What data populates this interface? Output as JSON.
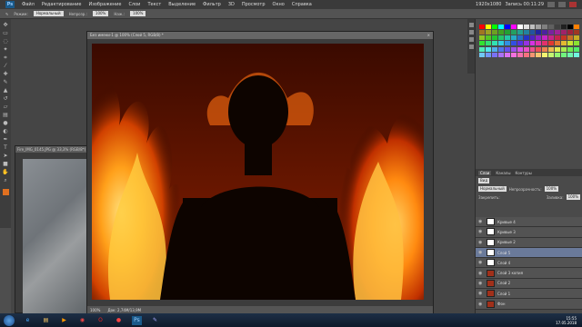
{
  "menubar": {
    "logo": "Ps",
    "items": [
      "Файл",
      "Редактирование",
      "Изображение",
      "Слои",
      "Текст",
      "Выделение",
      "Фильтр",
      "3D",
      "Просмотр",
      "Окно",
      "Справка"
    ],
    "right_text": "1920x1080",
    "right_text2": "Запись 00:11:29"
  },
  "options": {
    "mode_label": "Режим:",
    "mode_value": "Нормальный",
    "opacity_label": "Непрозр.:",
    "opacity_value": "100%",
    "flow_label": "Наж.:",
    "flow_value": "100%"
  },
  "documents": {
    "back_title": "Fire_IMG_0145.JPG @ 33,3% (RGB/8*)",
    "main_title": "Без имени-1 @ 100% (Слой 5, RGB/8) *",
    "main_close": "×",
    "zoom": "100%",
    "doc_size": "Док: 2,74М/13,9М"
  },
  "layers_panel": {
    "tabs": [
      "Слои",
      "Каналы",
      "Контуры"
    ],
    "kind_label": "Вид",
    "blend_value": "Нормальный",
    "opacity_label": "Непрозрачность:",
    "opacity_value": "100%",
    "lock_label": "Закрепить:",
    "fill_label": "Заливка:",
    "fill_value": "100%",
    "layers": [
      {
        "name": "Кривые 4",
        "selected": false
      },
      {
        "name": "Кривые 3",
        "selected": false
      },
      {
        "name": "Кривые 2",
        "selected": false
      },
      {
        "name": "Слой 5",
        "selected": true
      },
      {
        "name": "Слой 4",
        "selected": false
      },
      {
        "name": "Слой 3 копия",
        "selected": false
      },
      {
        "name": "Слой 2",
        "selected": false
      },
      {
        "name": "Слой 1",
        "selected": false
      },
      {
        "name": "Фон",
        "selected": false
      }
    ]
  },
  "taskbar": {
    "time": "15:55",
    "date": "17.05.2018"
  },
  "colors": {
    "foreground": "#e07020",
    "selected_layer": "#6a7a9a"
  }
}
